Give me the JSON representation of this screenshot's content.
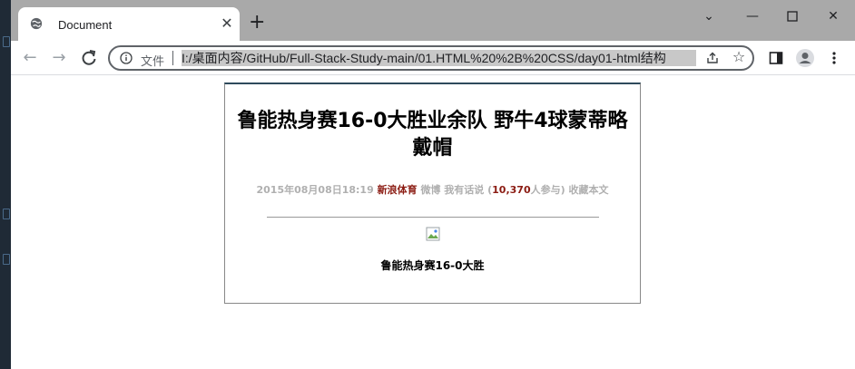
{
  "browser": {
    "tab_title": "Document",
    "new_tab_label": "+",
    "omnibox_chip": "文件",
    "url": "I:/桌面内容/GitHub/Full-Stack-Study-main/01.HTML%20%2B%20CSS/day01-html结构"
  },
  "article": {
    "headline": "鲁能热身赛16-0大胜业余队 野牛4球蒙蒂略戴帽",
    "meta": {
      "datetime": "2015年08月08日18:19",
      "source": "新浪体育",
      "weibo": "微博",
      "comment": "我有话说",
      "open_paren": "(",
      "count": "10,370",
      "participants": "人参与)",
      "favorite": "收藏本文"
    },
    "caption": "鲁能热身赛16-0大胜"
  },
  "colors": {
    "tabstrip": "#a9a9a9",
    "source_red": "#8b1b12",
    "meta_gray": "#b0b0b0"
  }
}
